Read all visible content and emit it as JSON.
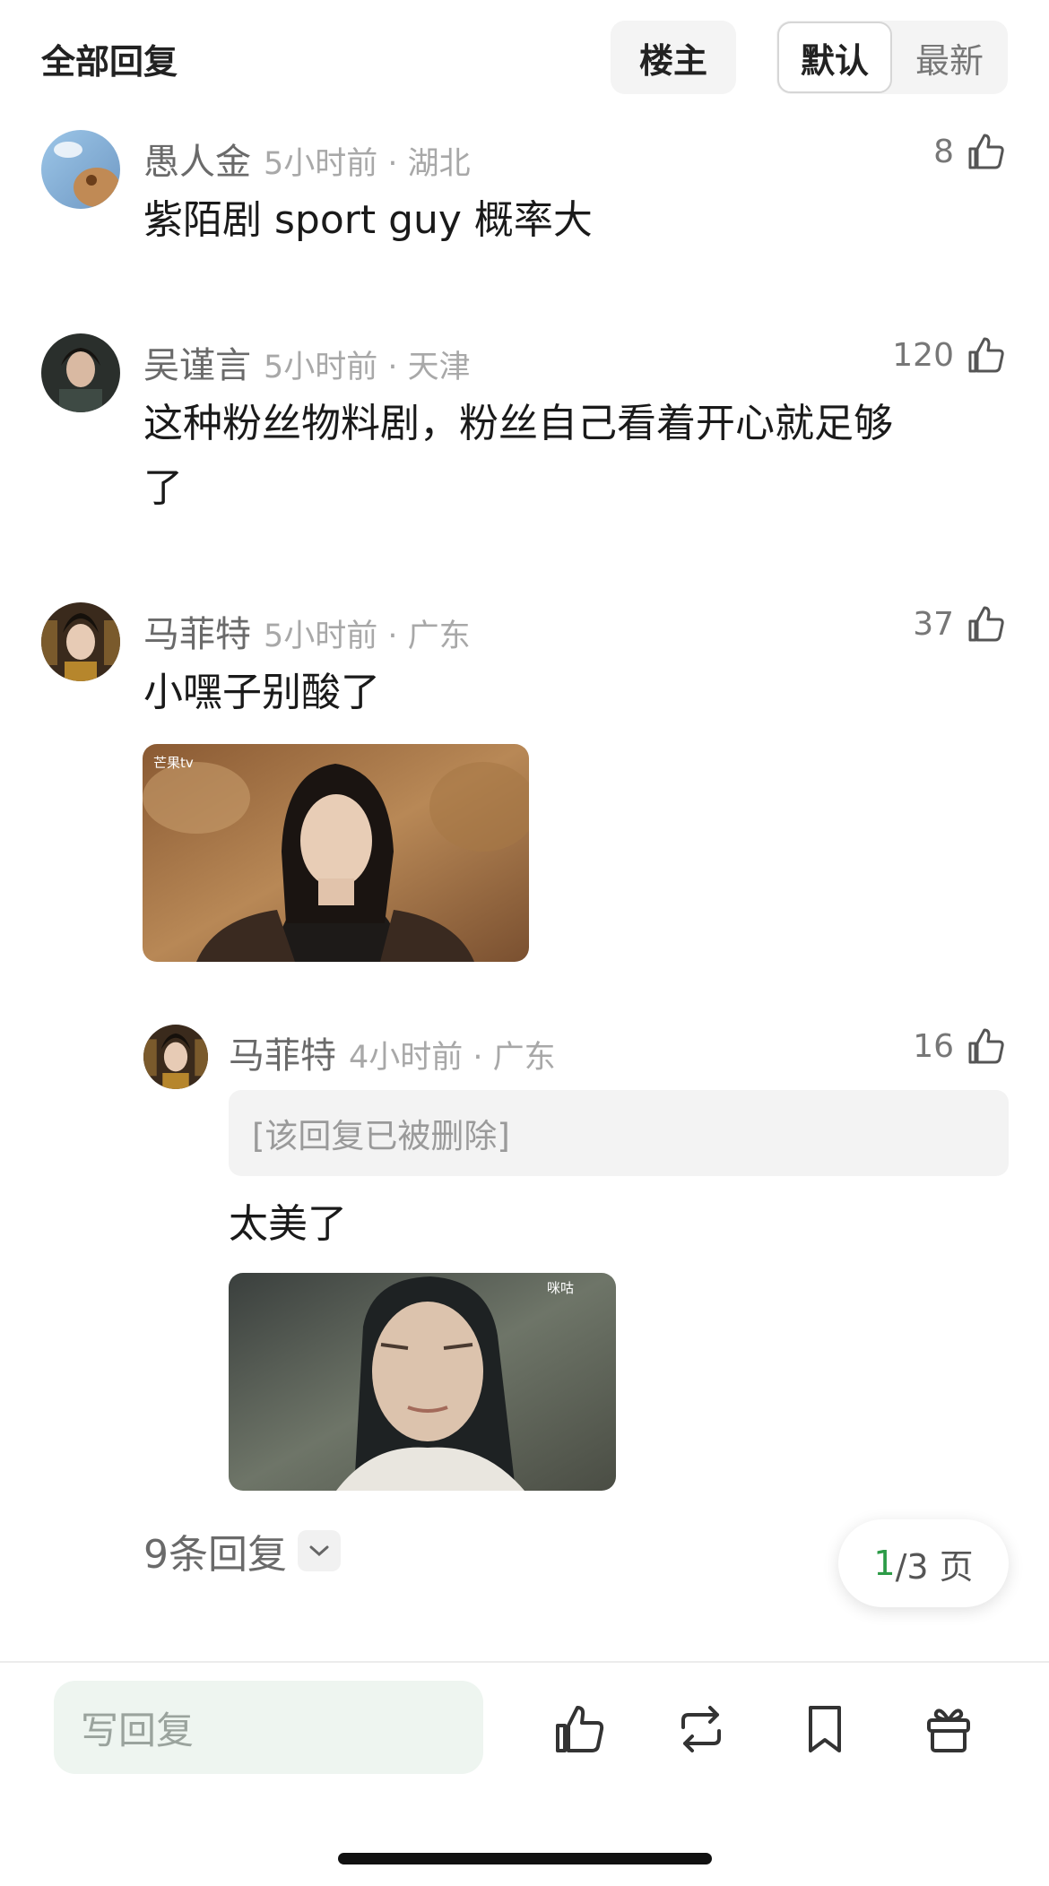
{
  "header": {
    "title": "全部回复",
    "op_label": "楼主",
    "sort_default": "默认",
    "sort_latest": "最新"
  },
  "comments": [
    {
      "name": "愚人金",
      "time": "5小时前 · 湖北",
      "likes": "8",
      "text": "紫陌剧 sport guy 概率大"
    },
    {
      "name": "吴谨言",
      "time": "5小时前 · 天津",
      "likes": "120",
      "text_line1": "这种粉丝物料剧，粉丝自己看着开心就足够",
      "text_line2": "了"
    },
    {
      "name": "马菲特",
      "time": "5小时前 · 广东",
      "likes": "37",
      "text": "小嘿子别酸了",
      "image_watermark": "芒果tv"
    }
  ],
  "reply": {
    "name": "马菲特",
    "time": "4小时前 · 广东",
    "likes": "16",
    "quoted_deleted": "[该回复已被删除]",
    "text": "太美了",
    "image_watermark": "咪咕"
  },
  "more_replies": "9条回复",
  "pager": {
    "current": "1",
    "total_text": "/3 页"
  },
  "toolbar": {
    "reply_placeholder": "写回复",
    "icons": [
      "like-icon",
      "repost-icon",
      "bookmark-icon",
      "gift-icon"
    ]
  },
  "colors": {
    "accent_green": "#2c9b47",
    "input_bg": "#eef5f0"
  }
}
